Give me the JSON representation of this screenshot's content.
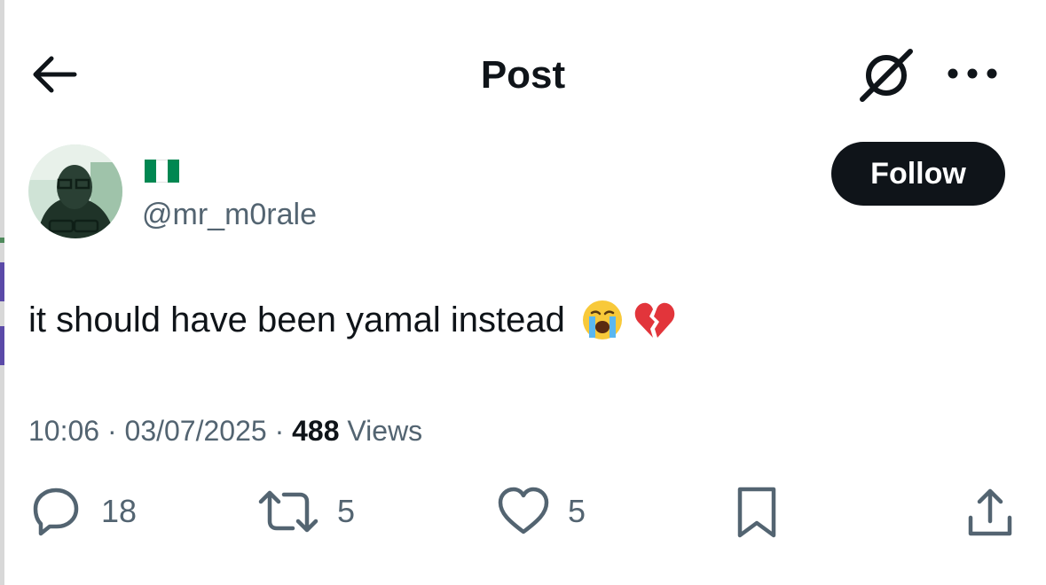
{
  "header": {
    "title": "Post",
    "back_icon": "arrow-left-icon",
    "grok_icon": "grok-icon",
    "more_icon": "more-horizontal-icon"
  },
  "author": {
    "flag": "nigeria-flag",
    "handle": "@mr_m0rale",
    "follow_label": "Follow"
  },
  "post": {
    "text": "it should have been yamal instead",
    "emojis": [
      "loudly-crying-face",
      "broken-heart"
    ]
  },
  "meta": {
    "time": "10:06",
    "separator": "·",
    "date": "03/07/2025",
    "views_count": "488",
    "views_label": "Views"
  },
  "actions": {
    "replies": "18",
    "reposts": "5",
    "likes": "5"
  },
  "colors": {
    "text_primary": "#0f1419",
    "text_secondary": "#536471",
    "button_bg": "#0f1419",
    "flag_green": "#008751"
  }
}
